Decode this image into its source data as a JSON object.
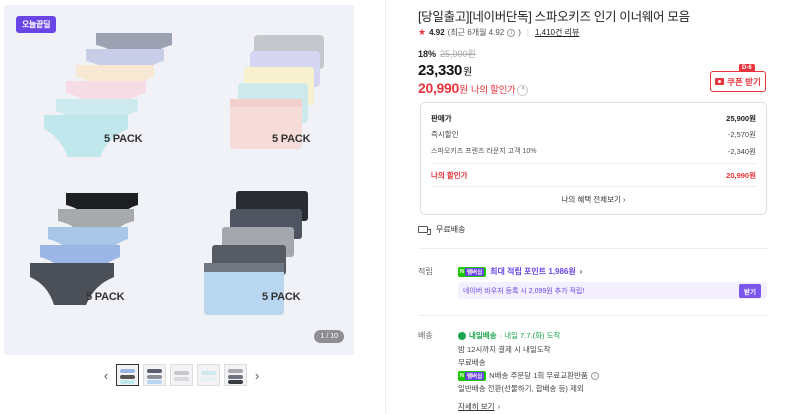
{
  "gallery": {
    "badge": "오늘끝딜",
    "pack_labels": [
      "5 PACK",
      "5 PACK",
      "5 PACK",
      "5 PACK"
    ],
    "counter": "1 / 10",
    "prev_arrow": "‹",
    "next_arrow": "›",
    "thumb_count": 5
  },
  "product": {
    "title": "[당일출고][네이버단독] 스파오키즈 인기 이너웨어 모음",
    "rating": "4.92",
    "rating_detail": "(최근 6개월 4.92",
    "reviews": "1,410건 리뷰",
    "discount_rate": "18%",
    "original_price": "25,900원",
    "price": "23,330",
    "price_unit": "원",
    "my_price": "20,990",
    "my_price_unit": "원",
    "my_price_label": "나의 할인가"
  },
  "coupon": {
    "tag": "D-6",
    "label": "쿠폰 받기"
  },
  "price_box": {
    "rows": [
      {
        "label": "판매가",
        "value": "25,900원"
      },
      {
        "label": "즉시할인",
        "value": "-2,570원"
      },
      {
        "label": "스파오키즈 프렌즈 라운지 고객 10%",
        "value": "-2,340원"
      },
      {
        "label": "나의 할인가",
        "value": "20,990원"
      }
    ],
    "benefit_link": "나의 혜택 전체보기"
  },
  "shipping_free": "무료배송",
  "points": {
    "section_label": "적립",
    "badge_n": "N",
    "badge_plus": "멤버십",
    "text": "최대 적립 포인트 1,986원",
    "pay_text": "네이버 바우처 등록 시 2,099원 추가 적립!",
    "pay_button": "받기"
  },
  "delivery": {
    "section_label": "배송",
    "arrival_tag": "내일배송",
    "arrival_text": "· 내일 7.7.(화) 도착",
    "cutoff": "밤 12시까지 결제 시 내일도착",
    "free": "무료배송",
    "badge_n": "N",
    "badge_plus": "멤버십",
    "return_text": "N배송 주문당 1회 무료교환반품",
    "excluded": "일반배송 전환(선물하기, 합배송 등) 제외",
    "detail_link": "자세히 보기"
  }
}
